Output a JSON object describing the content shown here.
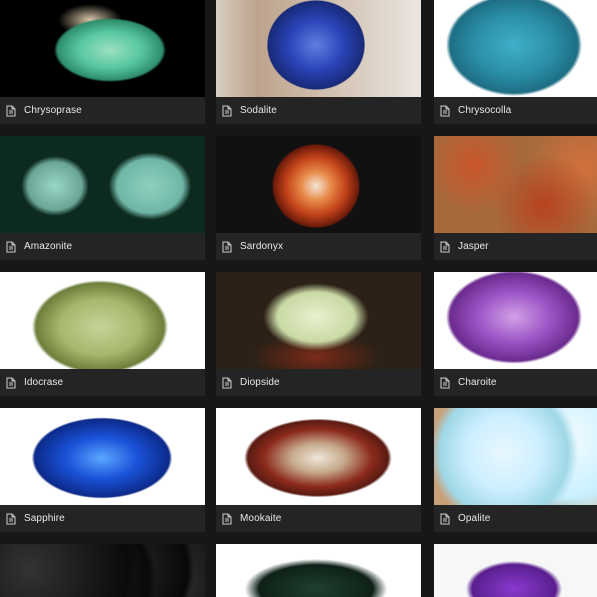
{
  "gallery": {
    "items": [
      {
        "label": "Chrysoprase"
      },
      {
        "label": "Sodalite"
      },
      {
        "label": "Chrysocolla"
      },
      {
        "label": "Amazonite"
      },
      {
        "label": "Sardonyx"
      },
      {
        "label": "Jasper"
      },
      {
        "label": "Idocrase"
      },
      {
        "label": "Diopside"
      },
      {
        "label": "Charoite"
      },
      {
        "label": "Sapphire"
      },
      {
        "label": "Mookaite"
      },
      {
        "label": "Opalite"
      }
    ],
    "icon": "file-icon",
    "colors": {
      "background": "#171717",
      "card": "#242424",
      "text": "#e8e8e8"
    }
  }
}
